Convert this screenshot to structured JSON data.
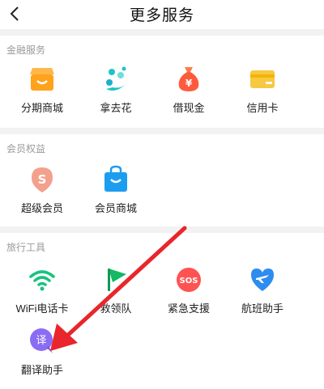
{
  "header": {
    "title": "更多服务",
    "back_icon": "chevron-left-icon"
  },
  "sections": [
    {
      "title": "金融服务",
      "items": [
        {
          "label": "分期商城",
          "icon": "shop-icon",
          "color": "#ffa21c"
        },
        {
          "label": "拿去花",
          "icon": "flower-icon",
          "color": "#1cc4c9"
        },
        {
          "label": "借现金",
          "icon": "money-bag-icon",
          "color": "#ff5a3c"
        },
        {
          "label": "信用卡",
          "icon": "credit-card-icon",
          "color": "#f6c843"
        }
      ]
    },
    {
      "title": "会员权益",
      "items": [
        {
          "label": "超级会员",
          "icon": "super-member-icon",
          "color": "#f3a08c"
        },
        {
          "label": "会员商城",
          "icon": "shopping-bag-icon",
          "color": "#1c9df0"
        }
      ]
    },
    {
      "title": "旅行工具",
      "items": [
        {
          "label": "WiFi电话卡",
          "icon": "wifi-icon",
          "color": "#17c27e"
        },
        {
          "label": "救领队",
          "icon": "flag-icon",
          "color": "#14b865"
        },
        {
          "label": "紧急支援",
          "icon": "sos-icon",
          "color": "#ff5252",
          "icon_text": "SOS"
        },
        {
          "label": "航班助手",
          "icon": "flight-heart-icon",
          "color": "#2d8cf0"
        },
        {
          "label": "翻译助手",
          "icon": "translate-icon",
          "color": "#8b6cf5",
          "icon_text": "译"
        }
      ]
    }
  ]
}
